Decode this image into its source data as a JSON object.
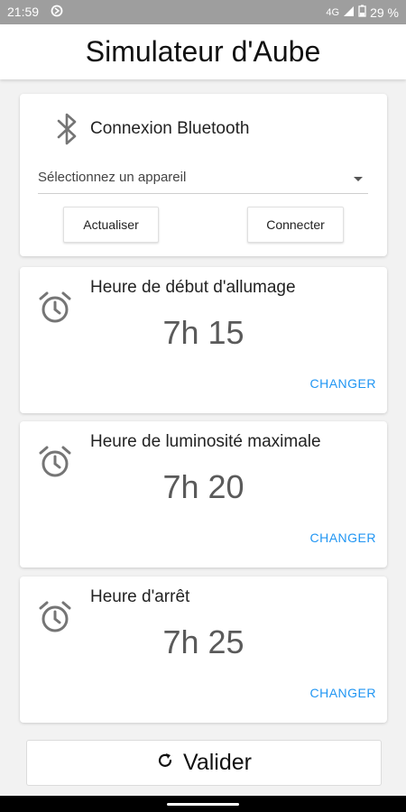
{
  "status_bar": {
    "time": "21:59",
    "network": "4G",
    "battery": "29 %"
  },
  "app_title": "Simulateur d'Aube",
  "bluetooth": {
    "title": "Connexion Bluetooth",
    "select_value": "Sélectionnez un appareil",
    "refresh_label": "Actualiser",
    "connect_label": "Connecter"
  },
  "cards": [
    {
      "title": "Heure de début d'allumage",
      "value": "7h 15",
      "action": "CHANGER"
    },
    {
      "title": "Heure de luminosité maximale",
      "value": "7h 20",
      "action": "CHANGER"
    },
    {
      "title": "Heure d'arrêt",
      "value": "7h 25",
      "action": "CHANGER"
    }
  ],
  "validate_label": "Valider",
  "icons": {
    "bluetooth": "bluetooth-icon",
    "alarm": "alarm-clock-icon",
    "refresh": "refresh-icon"
  },
  "colors": {
    "accent": "#2196f3",
    "status_bar": "#9e9e9e"
  }
}
